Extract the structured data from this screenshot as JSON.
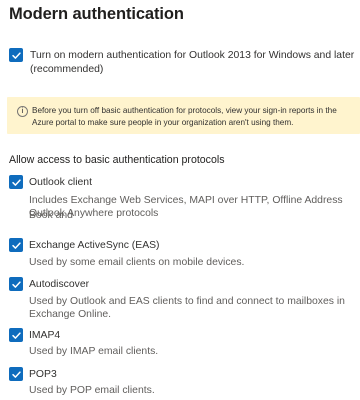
{
  "page": {
    "title": "Modern authentication",
    "modern_auth": {
      "label": "Turn on modern authentication for Outlook 2013 for Windows and later",
      "label_cont": "(recommended)",
      "checked": true
    },
    "info": {
      "icon": "info-icon",
      "line1": "Before you turn off basic authentication for protocols, view your sign-in reports in the",
      "line2": "Azure portal to make sure people in your organization aren't using them."
    },
    "section_title": "Allow access to basic authentication protocols",
    "protocols": [
      {
        "name": "Outlook client",
        "desc1": "Includes Exchange Web Services, MAPI over HTTP, Offline Address Book and",
        "desc2": "Outlook Anywhere protocols",
        "checked": true
      },
      {
        "name": "Exchange ActiveSync (EAS)",
        "desc1": "Used by some email clients on mobile devices.",
        "checked": true
      },
      {
        "name": "Autodiscover",
        "desc1": "Used by Outlook and EAS clients to find and connect to mailboxes in",
        "desc2": "Exchange Online.",
        "checked": true
      },
      {
        "name": "IMAP4",
        "desc1": "Used by IMAP email clients.",
        "checked": true
      },
      {
        "name": "POP3",
        "desc1": "Used by POP email clients.",
        "checked": true
      }
    ]
  },
  "colors": {
    "checkbox": "#0f6cbd",
    "info_bar": "#fff4ce",
    "text": "#323130",
    "secondary_text": "#605e5c"
  }
}
